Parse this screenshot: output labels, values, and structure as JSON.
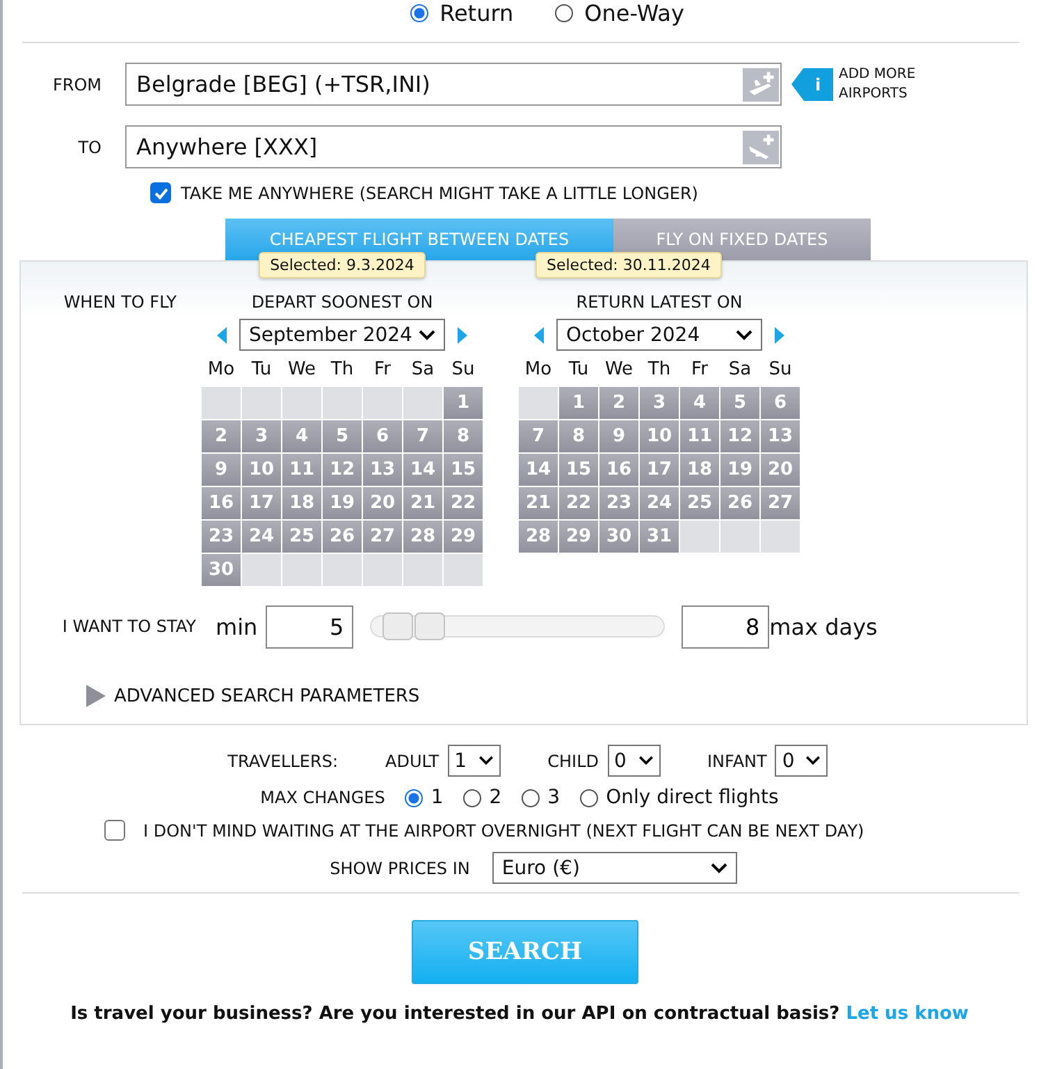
{
  "trip_type": [
    {
      "label": "Return",
      "selected": true
    },
    {
      "label": "One-Way",
      "selected": false
    }
  ],
  "from": {
    "label": "FROM",
    "value": "Belgrade [BEG] (+TSR,INI)"
  },
  "to": {
    "label": "TO",
    "value": "Anywhere [XXX]"
  },
  "add_more": {
    "icon": "i",
    "label": "ADD MORE AIRPORTS"
  },
  "anywhere": {
    "label": "TAKE ME ANYWHERE (SEARCH MIGHT TAKE A LITTLE LONGER)",
    "checked": true
  },
  "tabs": [
    {
      "label": "CHEAPEST FLIGHT BETWEEN DATES",
      "selected": true
    },
    {
      "label": "FLY ON FIXED DATES",
      "selected": false
    }
  ],
  "when_label": "WHEN TO FLY",
  "calendars": [
    {
      "tooltip": "Selected: 9.3.2024",
      "title": "DEPART SOONEST ON",
      "month": "September 2024",
      "weekdays": [
        "Mo",
        "Tu",
        "We",
        "Th",
        "Fr",
        "Sa",
        "Su"
      ],
      "cells": [
        {
          "kind": "blank"
        },
        {
          "kind": "blank"
        },
        {
          "kind": "blank"
        },
        {
          "kind": "blank"
        },
        {
          "kind": "blank"
        },
        {
          "kind": "blank"
        },
        {
          "kind": "day",
          "label": "1"
        },
        {
          "kind": "day",
          "label": "2"
        },
        {
          "kind": "day",
          "label": "3"
        },
        {
          "kind": "day",
          "label": "4"
        },
        {
          "kind": "day",
          "label": "5"
        },
        {
          "kind": "day",
          "label": "6"
        },
        {
          "kind": "day",
          "label": "7"
        },
        {
          "kind": "day",
          "label": "8"
        },
        {
          "kind": "day",
          "label": "9"
        },
        {
          "kind": "day",
          "label": "10"
        },
        {
          "kind": "day",
          "label": "11"
        },
        {
          "kind": "day",
          "label": "12"
        },
        {
          "kind": "day",
          "label": "13"
        },
        {
          "kind": "day",
          "label": "14"
        },
        {
          "kind": "day",
          "label": "15"
        },
        {
          "kind": "day",
          "label": "16"
        },
        {
          "kind": "day",
          "label": "17"
        },
        {
          "kind": "day",
          "label": "18"
        },
        {
          "kind": "day",
          "label": "19"
        },
        {
          "kind": "day",
          "label": "20"
        },
        {
          "kind": "day",
          "label": "21"
        },
        {
          "kind": "day",
          "label": "22"
        },
        {
          "kind": "day",
          "label": "23"
        },
        {
          "kind": "day",
          "label": "24"
        },
        {
          "kind": "day",
          "label": "25"
        },
        {
          "kind": "day",
          "label": "26"
        },
        {
          "kind": "day",
          "label": "27"
        },
        {
          "kind": "day",
          "label": "28"
        },
        {
          "kind": "day",
          "label": "29"
        },
        {
          "kind": "day",
          "label": "30"
        },
        {
          "kind": "blank"
        },
        {
          "kind": "blank"
        },
        {
          "kind": "blank"
        },
        {
          "kind": "blank"
        },
        {
          "kind": "blank"
        },
        {
          "kind": "blank"
        }
      ]
    },
    {
      "tooltip": "Selected: 30.11.2024",
      "title": "RETURN LATEST ON",
      "month": "October 2024",
      "weekdays": [
        "Mo",
        "Tu",
        "We",
        "Th",
        "Fr",
        "Sa",
        "Su"
      ],
      "cells": [
        {
          "kind": "blank"
        },
        {
          "kind": "day",
          "label": "1"
        },
        {
          "kind": "day",
          "label": "2"
        },
        {
          "kind": "day",
          "label": "3"
        },
        {
          "kind": "day",
          "label": "4"
        },
        {
          "kind": "day",
          "label": "5"
        },
        {
          "kind": "day",
          "label": "6"
        },
        {
          "kind": "day",
          "label": "7"
        },
        {
          "kind": "day",
          "label": "8"
        },
        {
          "kind": "day",
          "label": "9"
        },
        {
          "kind": "day",
          "label": "10"
        },
        {
          "kind": "day",
          "label": "11"
        },
        {
          "kind": "day",
          "label": "12"
        },
        {
          "kind": "day",
          "label": "13"
        },
        {
          "kind": "day",
          "label": "14"
        },
        {
          "kind": "day",
          "label": "15"
        },
        {
          "kind": "day",
          "label": "16"
        },
        {
          "kind": "day",
          "label": "17"
        },
        {
          "kind": "day",
          "label": "18"
        },
        {
          "kind": "day",
          "label": "19"
        },
        {
          "kind": "day",
          "label": "20"
        },
        {
          "kind": "day",
          "label": "21"
        },
        {
          "kind": "day",
          "label": "22"
        },
        {
          "kind": "day",
          "label": "23"
        },
        {
          "kind": "day",
          "label": "24"
        },
        {
          "kind": "day",
          "label": "25"
        },
        {
          "kind": "day",
          "label": "26"
        },
        {
          "kind": "day",
          "label": "27"
        },
        {
          "kind": "day",
          "label": "28"
        },
        {
          "kind": "day",
          "label": "29"
        },
        {
          "kind": "day",
          "label": "30"
        },
        {
          "kind": "day",
          "label": "31"
        },
        {
          "kind": "blank"
        },
        {
          "kind": "blank"
        },
        {
          "kind": "blank"
        }
      ]
    }
  ],
  "stay": {
    "label": "I WANT TO STAY",
    "min_label": "min",
    "min": "5",
    "max": "8",
    "max_label": "max days",
    "thumbs": [
      {
        "level": 0.04
      },
      {
        "level": 0.16
      }
    ]
  },
  "advanced": {
    "label": "ADVANCED SEARCH PARAMETERS",
    "expanded": false
  },
  "travellers": {
    "label": "TRAVELLERS:",
    "fields": [
      {
        "label": "ADULT",
        "value": "1"
      },
      {
        "label": "CHILD",
        "value": "0"
      },
      {
        "label": "INFANT",
        "value": "0"
      }
    ]
  },
  "max_changes": {
    "label": "MAX CHANGES",
    "options": [
      {
        "label": "1",
        "selected": true
      },
      {
        "label": "2",
        "selected": false
      },
      {
        "label": "3",
        "selected": false
      },
      {
        "label": "Only direct flights",
        "selected": false
      }
    ]
  },
  "overnight": {
    "label": "I DON'T MIND WAITING AT THE AIRPORT OVERNIGHT (NEXT FLIGHT CAN BE NEXT DAY)",
    "checked": false
  },
  "currency": {
    "label": "SHOW PRICES IN",
    "value": "Euro (€)"
  },
  "search_button": "SEARCH",
  "footer": {
    "text": "Is travel your business? Are you interested in our API on contractual basis?",
    "link": "Let us know"
  }
}
